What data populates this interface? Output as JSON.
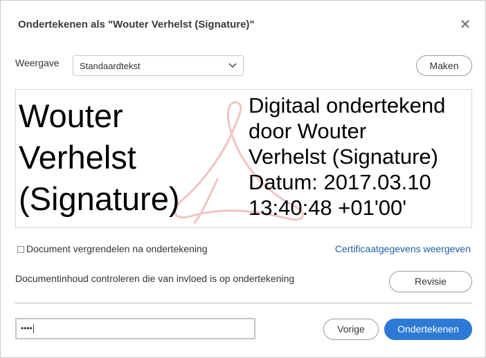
{
  "dialog": {
    "title": "Ondertekenen als \"Wouter Verhelst (Signature)\"",
    "close_icon": "close-icon"
  },
  "appearance": {
    "label": "Weergave",
    "selected": "Standaardtekst",
    "create_button": "Maken"
  },
  "preview": {
    "name_lines": [
      "Wouter",
      "Verhelst",
      "(Signature)"
    ],
    "detail_lines": [
      "Digitaal ondertekend",
      "door Wouter",
      "Verhelst (Signature)",
      "Datum: 2017.03.10",
      "13:40:48 +01'00'"
    ],
    "watermark_icon": "acrobat-logo-icon"
  },
  "options": {
    "lock_label": "Document vergrendelen na ondertekening",
    "lock_checked": false,
    "cert_link": "Certificaatgegevens weergeven",
    "review_text": "Documentinhoud controleren die van invloed is op ondertekening",
    "review_button": "Revisie"
  },
  "footer": {
    "password_value": "••••",
    "back_button": "Vorige",
    "sign_button": "Ondertekenen"
  },
  "colors": {
    "primary": "#2d7ad6",
    "link": "#1f5ea8",
    "watermark": "#f0c4c4"
  }
}
